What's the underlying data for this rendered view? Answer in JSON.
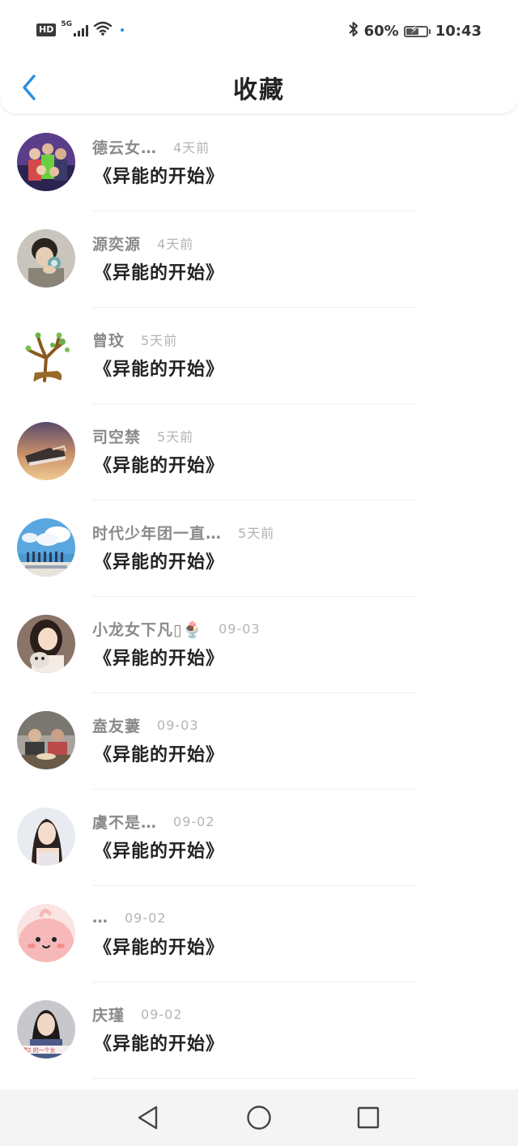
{
  "status_bar": {
    "hd": "HD",
    "network": "5G",
    "battery_percent": "60%",
    "battery_level": 0.6,
    "time": "10:43",
    "icons": [
      "signal-icon",
      "wifi-icon",
      "bluetooth-icon",
      "battery-icon"
    ]
  },
  "header": {
    "title": "收藏",
    "back_icon": "chevron-left-icon"
  },
  "colors": {
    "accent": "#2b8fe0",
    "title": "#222222",
    "username": "#8a8a8a",
    "time": "#b4b4b4"
  },
  "items": [
    {
      "name": "德云女…",
      "time": "4天前",
      "title": "《异能的开始》"
    },
    {
      "name": "源奕源",
      "time": "4天前",
      "title": "《异能的开始》"
    },
    {
      "name": "曾玟",
      "time": "5天前",
      "title": "《异能的开始》"
    },
    {
      "name": "司空禁",
      "time": "5天前",
      "title": "《异能的开始》"
    },
    {
      "name": "时代少年团一直…",
      "time": "5天前",
      "title": "《异能的开始》"
    },
    {
      "name": "小龙女下凡▯🍨",
      "time": "09-03",
      "title": "《异能的开始》"
    },
    {
      "name": "盍友萋",
      "time": "09-03",
      "title": "《异能的开始》"
    },
    {
      "name": "虞不是…",
      "time": "09-02",
      "title": "《异能的开始》"
    },
    {
      "name": "…",
      "time": "09-02",
      "title": "《异能的开始》"
    },
    {
      "name": "庆瑾",
      "time": "09-02",
      "title": "《异能的开始》"
    }
  ],
  "nav": {
    "icons": [
      "nav-back-icon",
      "nav-home-icon",
      "nav-recent-icon"
    ]
  }
}
